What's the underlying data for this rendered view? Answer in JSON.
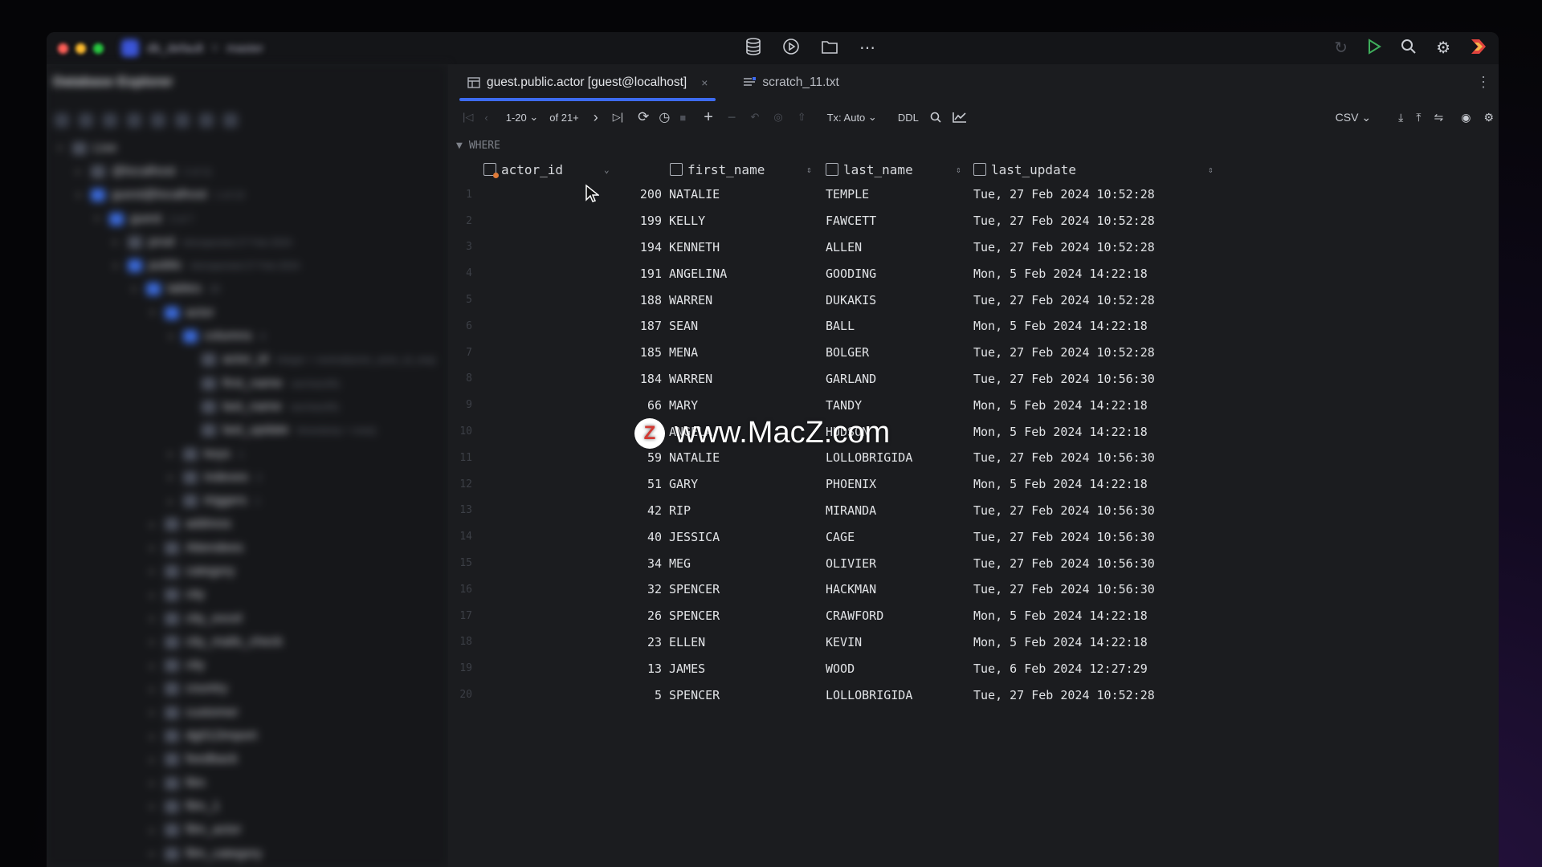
{
  "titlebar": {
    "project_name": "db_default",
    "branch": "master",
    "colors": {
      "close": "#ff5f57",
      "minimize": "#febc2e",
      "maximize": "#28c840",
      "accent": "#3d6bf0",
      "run": "#3fae5c"
    }
  },
  "explorer": {
    "title": "Database Explorer",
    "tree": [
      {
        "label": "Live",
        "level": 0,
        "arrow": "▾"
      },
      {
        "label": "@localhost",
        "meta": "2 of 11",
        "level": 1,
        "arrow": "▸"
      },
      {
        "label": "guest@localhost",
        "meta": "1 of 13",
        "level": 1,
        "arrow": "▾"
      },
      {
        "label": "guest",
        "meta": "2 of 7",
        "level": 2,
        "arrow": "▾"
      },
      {
        "label": "prod",
        "meta": "introspected 27 Feb 2024",
        "level": 3,
        "arrow": "▸"
      },
      {
        "label": "public",
        "meta": "introspected 27 Feb 2024",
        "level": 3,
        "arrow": "▾"
      },
      {
        "label": "tables",
        "meta": "20",
        "level": 4,
        "arrow": "▾"
      },
      {
        "label": "actor",
        "level": 5,
        "arrow": "▾"
      },
      {
        "label": "columns",
        "meta": "4",
        "level": 6,
        "arrow": "▾"
      },
      {
        "label": "actor_id",
        "meta": "integer = nextval(actor_actor_id_seq)",
        "level": 7,
        "arrow": ""
      },
      {
        "label": "first_name",
        "meta": "varchar(45)",
        "level": 7,
        "arrow": ""
      },
      {
        "label": "last_name",
        "meta": "varchar(45)",
        "level": 7,
        "arrow": ""
      },
      {
        "label": "last_update",
        "meta": "timestamp = now()",
        "level": 7,
        "arrow": ""
      },
      {
        "label": "keys",
        "meta": "1",
        "level": 6,
        "arrow": "▸"
      },
      {
        "label": "indexes",
        "meta": "2",
        "level": 6,
        "arrow": "▸"
      },
      {
        "label": "triggers",
        "meta": "1",
        "level": 6,
        "arrow": "▸"
      },
      {
        "label": "address",
        "level": 5,
        "arrow": "▸"
      },
      {
        "label": "Attendees",
        "level": 5,
        "arrow": "▸"
      },
      {
        "label": "category",
        "level": 5,
        "arrow": "▸"
      },
      {
        "label": "city",
        "level": 5,
        "arrow": "▸"
      },
      {
        "label": "city_excel",
        "level": 5,
        "arrow": "▸"
      },
      {
        "label": "city_mails_check",
        "level": 5,
        "arrow": "▸"
      },
      {
        "label": "city",
        "level": 5,
        "arrow": "▸"
      },
      {
        "label": "country",
        "level": 5,
        "arrow": "▸"
      },
      {
        "label": "customer",
        "level": 5,
        "arrow": "▸"
      },
      {
        "label": "dg012import",
        "level": 5,
        "arrow": "▸"
      },
      {
        "label": "feedback",
        "level": 5,
        "arrow": "▸"
      },
      {
        "label": "film",
        "level": 5,
        "arrow": "▸"
      },
      {
        "label": "film_1",
        "level": 5,
        "arrow": "▸"
      },
      {
        "label": "film_actor",
        "level": 5,
        "arrow": "▸"
      },
      {
        "label": "film_category",
        "level": 5,
        "arrow": "▸"
      }
    ]
  },
  "tabs": [
    {
      "label": "guest.public.actor [guest@localhost]",
      "active": true,
      "close": "×"
    },
    {
      "label": "scratch_11.txt",
      "active": false
    }
  ],
  "toolbar": {
    "range": "1-20",
    "of_total": "of 21+",
    "tx_mode": "Tx: Auto",
    "ddl": "DDL",
    "export_format": "CSV"
  },
  "where_label": "WHERE",
  "grid": {
    "columns": [
      "actor_id",
      "first_name",
      "last_name",
      "last_update"
    ],
    "rows": [
      [
        "1",
        "200",
        "NATALIE",
        "TEMPLE",
        "Tue, 27 Feb 2024 10:52:28"
      ],
      [
        "2",
        "199",
        "KELLY",
        "FAWCETT",
        "Tue, 27 Feb 2024 10:52:28"
      ],
      [
        "3",
        "194",
        "KENNETH",
        "ALLEN",
        "Tue, 27 Feb 2024 10:52:28"
      ],
      [
        "4",
        "191",
        "ANGELINA",
        "GOODING",
        "Mon, 5 Feb 2024 14:22:18"
      ],
      [
        "5",
        "188",
        "WARREN",
        "DUKAKIS",
        "Tue, 27 Feb 2024 10:52:28"
      ],
      [
        "6",
        "187",
        "SEAN",
        "BALL",
        "Mon, 5 Feb 2024 14:22:18"
      ],
      [
        "7",
        "185",
        "MENA",
        "BOLGER",
        "Tue, 27 Feb 2024 10:52:28"
      ],
      [
        "8",
        "184",
        "WARREN",
        "GARLAND",
        "Tue, 27 Feb 2024 10:56:30"
      ],
      [
        "9",
        "66",
        "MARY",
        "TANDY",
        "Mon, 5 Feb 2024 14:22:18"
      ],
      [
        "10",
        "65",
        "ANGELA",
        "HUDSON",
        "Mon, 5 Feb 2024 14:22:18"
      ],
      [
        "11",
        "59",
        "NATALIE",
        "LOLLOBRIGIDA",
        "Tue, 27 Feb 2024 10:56:30"
      ],
      [
        "12",
        "51",
        "GARY",
        "PHOENIX",
        "Mon, 5 Feb 2024 14:22:18"
      ],
      [
        "13",
        "42",
        "RIP",
        "MIRANDA",
        "Tue, 27 Feb 2024 10:56:30"
      ],
      [
        "14",
        "40",
        "JESSICA",
        "CAGE",
        "Tue, 27 Feb 2024 10:56:30"
      ],
      [
        "15",
        "34",
        "MEG",
        "OLIVIER",
        "Tue, 27 Feb 2024 10:56:30"
      ],
      [
        "16",
        "32",
        "SPENCER",
        "HACKMAN",
        "Tue, 27 Feb 2024 10:56:30"
      ],
      [
        "17",
        "26",
        "SPENCER",
        "CRAWFORD",
        "Mon, 5 Feb 2024 14:22:18"
      ],
      [
        "18",
        "23",
        "ELLEN",
        "KEVIN",
        "Mon, 5 Feb 2024 14:22:18"
      ],
      [
        "19",
        "13",
        "JAMES",
        "WOOD",
        "Tue, 6 Feb 2024 12:27:29"
      ],
      [
        "20",
        "5",
        "SPENCER",
        "LOLLOBRIGIDA",
        "Tue, 27 Feb 2024 10:52:28"
      ]
    ]
  },
  "watermark": {
    "logo_letter": "Z",
    "text": "www.MacZ.com"
  }
}
